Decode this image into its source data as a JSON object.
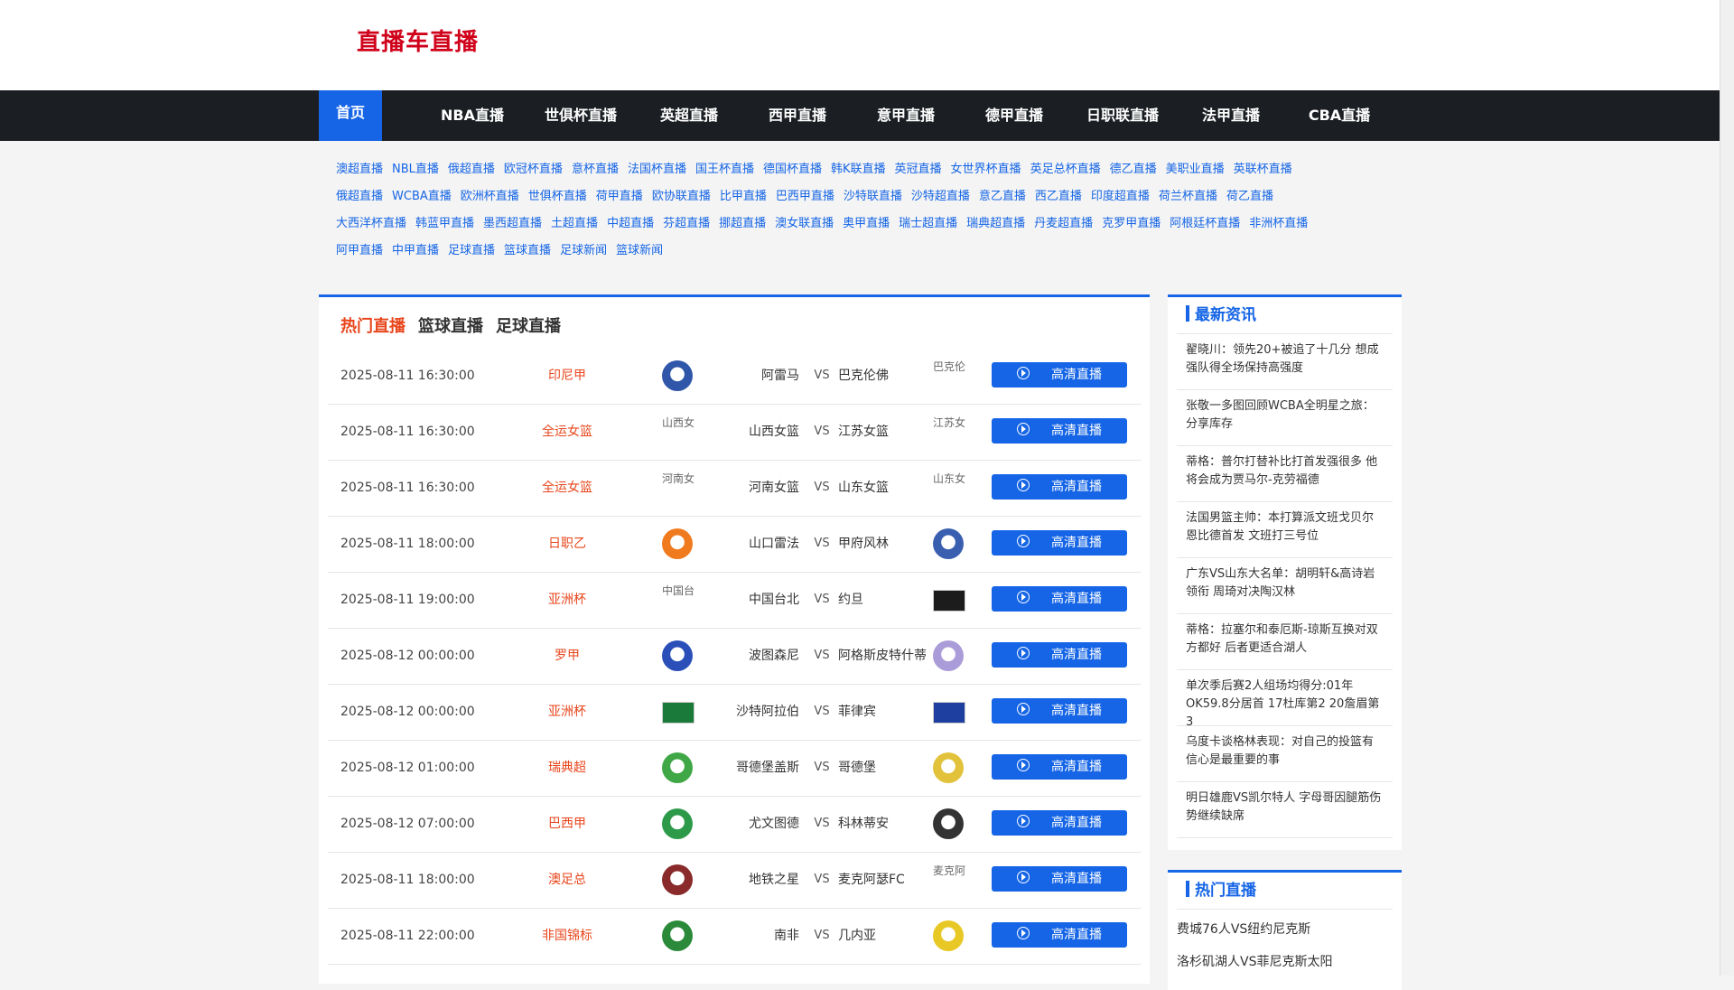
{
  "site": {
    "logo": "直播车直播"
  },
  "nav": {
    "home": "首页",
    "items": [
      "NBA直播",
      "世俱杯直播",
      "英超直播",
      "西甲直播",
      "意甲直播",
      "德甲直播",
      "日职联直播",
      "法甲直播",
      "CBA直播"
    ]
  },
  "links": [
    [
      "澳超直播",
      "NBL直播",
      "俄超直播",
      "欧冠杯直播",
      "意杯直播",
      "法国杯直播",
      "国王杯直播",
      "德国杯直播",
      "韩K联直播",
      "英冠直播",
      "女世界杯直播",
      "英足总杯直播",
      "德乙直播",
      "美职业直播",
      "英联杯直播"
    ],
    [
      "俄超直播",
      "WCBA直播",
      "欧洲杯直播",
      "世俱杯直播",
      "荷甲直播",
      "欧协联直播",
      "比甲直播",
      "巴西甲直播",
      "沙特联直播",
      "沙特超直播",
      "意乙直播",
      "西乙直播",
      "印度超直播",
      "荷兰杯直播",
      "荷乙直播"
    ],
    [
      "大西洋杯直播",
      "韩蓝甲直播",
      "墨西超直播",
      "土超直播",
      "中超直播",
      "芬超直播",
      "挪超直播",
      "澳女联直播",
      "奥甲直播",
      "瑞士超直播",
      "瑞典超直播",
      "丹麦超直播",
      "克罗甲直播",
      "阿根廷杯直播",
      "非洲杯直播"
    ],
    [
      "阿甲直播",
      "中甲直播",
      "足球直播",
      "篮球直播",
      "足球新闻",
      "篮球新闻"
    ]
  ],
  "tabs": [
    "热门直播",
    "篮球直播",
    "足球直播"
  ],
  "button_label": "高清直播",
  "vs_label": "VS",
  "matches": [
    {
      "time": "2025-08-11 16:30:00",
      "league": "印尼甲",
      "home": "阿雷马",
      "away": "巴克伦佛",
      "home_logo": {
        "type": "img",
        "color": "#2f56a8"
      },
      "away_logo": {
        "type": "text",
        "text": "巴克伦"
      }
    },
    {
      "time": "2025-08-11 16:30:00",
      "league": "全运女篮",
      "home": "山西女篮",
      "away": "江苏女篮",
      "home_logo": {
        "type": "text",
        "text": "山西女"
      },
      "away_logo": {
        "type": "text",
        "text": "江苏女"
      }
    },
    {
      "time": "2025-08-11 16:30:00",
      "league": "全运女篮",
      "home": "河南女篮",
      "away": "山东女篮",
      "home_logo": {
        "type": "text",
        "text": "河南女"
      },
      "away_logo": {
        "type": "text",
        "text": "山东女"
      }
    },
    {
      "time": "2025-08-11 18:00:00",
      "league": "日职乙",
      "home": "山口雷法",
      "away": "甲府风林",
      "home_logo": {
        "type": "img",
        "color": "#f07a1e"
      },
      "away_logo": {
        "type": "img",
        "color": "#3a5fb0"
      }
    },
    {
      "time": "2025-08-11 19:00:00",
      "league": "亚洲杯",
      "home": "中国台北",
      "away": "约旦",
      "home_logo": {
        "type": "text",
        "text": "中国台"
      },
      "away_logo": {
        "type": "flag",
        "color": "#1c1c1c"
      }
    },
    {
      "time": "2025-08-12 00:00:00",
      "league": "罗甲",
      "home": "波图森尼",
      "away": "阿格斯皮特什蒂",
      "home_logo": {
        "type": "img",
        "color": "#2a4fb8"
      },
      "away_logo": {
        "type": "img",
        "color": "#a99cd8"
      }
    },
    {
      "time": "2025-08-12 00:00:00",
      "league": "亚洲杯",
      "home": "沙特阿拉伯",
      "away": "菲律宾",
      "home_logo": {
        "type": "flag",
        "color": "#1a7a3a"
      },
      "away_logo": {
        "type": "flag",
        "color": "#1e3fa0"
      }
    },
    {
      "time": "2025-08-12 01:00:00",
      "league": "瑞典超",
      "home": "哥德堡盖斯",
      "away": "哥德堡",
      "home_logo": {
        "type": "img",
        "color": "#3fa745"
      },
      "away_logo": {
        "type": "img",
        "color": "#e2c23a"
      }
    },
    {
      "time": "2025-08-12 07:00:00",
      "league": "巴西甲",
      "home": "尤文图德",
      "away": "科林蒂安",
      "home_logo": {
        "type": "img",
        "color": "#2d9a4a"
      },
      "away_logo": {
        "type": "img",
        "color": "#333333"
      }
    },
    {
      "time": "2025-08-11 18:00:00",
      "league": "澳足总",
      "home": "地铁之星",
      "away": "麦克阿瑟FC",
      "home_logo": {
        "type": "img",
        "color": "#8a2a2a"
      },
      "away_logo": {
        "type": "text",
        "text": "麦克阿"
      }
    },
    {
      "time": "2025-08-11 22:00:00",
      "league": "非国锦标",
      "home": "南非",
      "away": "几内亚",
      "home_logo": {
        "type": "img",
        "color": "#2a8a3a"
      },
      "away_logo": {
        "type": "img",
        "color": "#e8c825"
      }
    }
  ],
  "sidebar": {
    "news_title": "最新资讯",
    "news": [
      "翟晓川：领先20+被追了十几分 想成强队得全场保持高强度",
      "张敬一多图回顾WCBA全明星之旅：分享库存",
      "蒂格：普尔打替补比打首发强很多 他将会成为贾马尔-克劳福德",
      "法国男篮主帅：本打算派文班戈贝尔恩比德首发 文班打三号位",
      "广东VS山东大名单：胡明轩&高诗岩领衔 周琦对决陶汉林",
      "蒂格：拉塞尔和泰厄斯-琼斯互换对双方都好 后者更适合湖人",
      "单次季后赛2人组场均得分:01年OK59.8分居首 17杜库第2 20詹眉第3",
      "乌度卡谈格林表现：对自己的投篮有信心是最重要的事",
      "明日雄鹿VS凯尔特人 字母哥因腿筋伤势继续缺席"
    ],
    "hot_title": "热门直播",
    "hot": [
      "费城76人VS纽约尼克斯",
      "洛杉矶湖人VS菲尼克斯太阳"
    ]
  }
}
